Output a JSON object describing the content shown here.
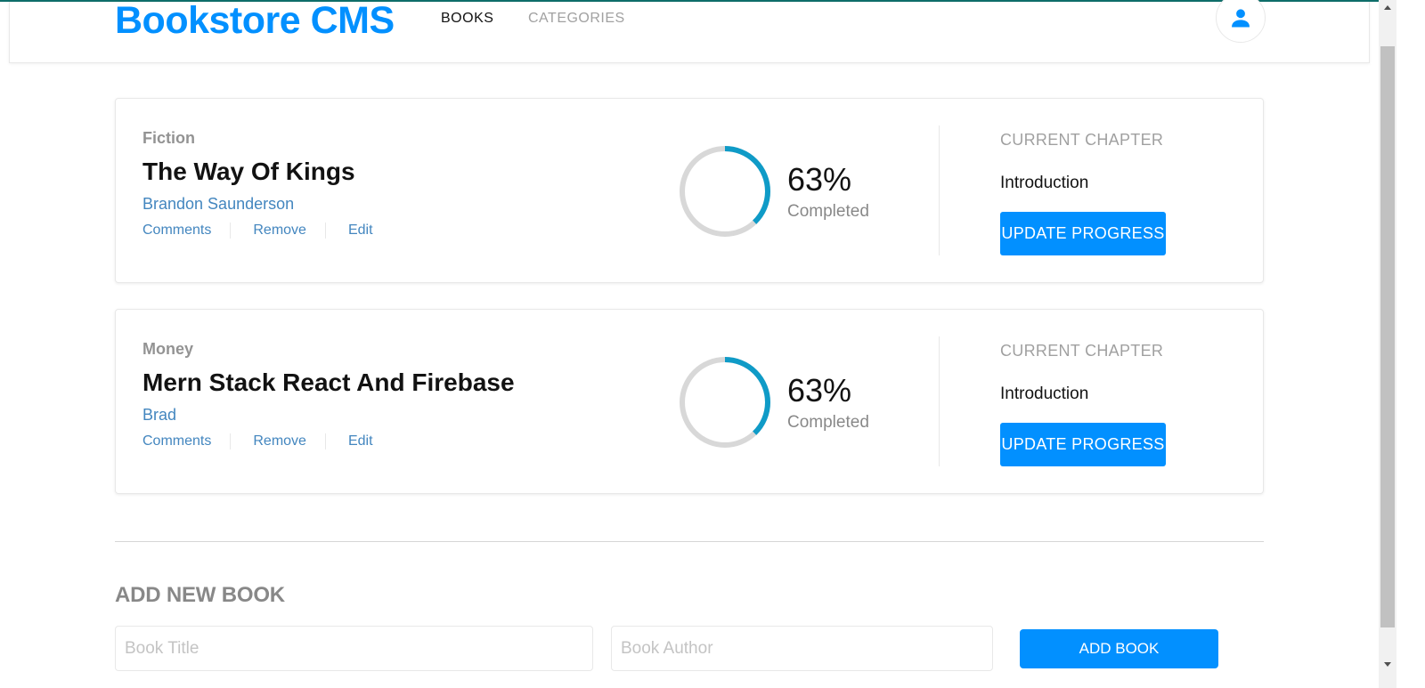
{
  "app": {
    "brand": "Bookstore CMS",
    "nav": [
      {
        "label": "BOOKS",
        "active": true
      },
      {
        "label": "CATEGORIES",
        "active": false
      }
    ],
    "avatar_icon": "user-icon"
  },
  "books": [
    {
      "genre": "Fiction",
      "title": "The Way Of Kings",
      "author": "Brandon Saunderson",
      "actions": [
        "Comments",
        "Remove",
        "Edit"
      ],
      "progress_percent": 63,
      "progress_label": "63%",
      "completed_label": "Completed",
      "chapter_label": "CURRENT CHAPTER",
      "chapter_value": "Introduction",
      "update_label": "UPDATE PROGRESS"
    },
    {
      "genre": "Money",
      "title": "Mern Stack React And Firebase",
      "author": "Brad",
      "actions": [
        "Comments",
        "Remove",
        "Edit"
      ],
      "progress_percent": 63,
      "progress_label": "63%",
      "completed_label": "Completed",
      "chapter_label": "CURRENT CHAPTER",
      "chapter_value": "Introduction",
      "update_label": "UPDATE PROGRESS"
    }
  ],
  "form": {
    "title": "ADD NEW BOOK",
    "title_placeholder": "Book Title",
    "author_placeholder": "Book Author",
    "submit_label": "ADD BOOK"
  },
  "colors": {
    "accent": "#0290ff",
    "ring_progress": "#0f9bc7",
    "ring_track": "#d8d8d8",
    "link": "#4386bf"
  }
}
